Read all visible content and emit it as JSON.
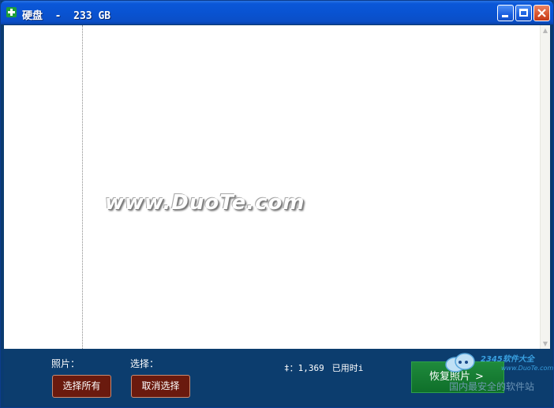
{
  "window": {
    "title": "硬盘  -  233 GB"
  },
  "watermark": "www.DuoTe.com",
  "footer": {
    "photos_label": "照片：",
    "selection_label": "选择：",
    "count_prefix": "‡：1,369",
    "used_time_label": "已用时i",
    "select_all_button": "选择所有",
    "deselect_button": "取消选择",
    "recover_button": "恢复照片",
    "recover_arrow": ">"
  },
  "site_badge": {
    "name": "2345软件大全",
    "url": "www.DuoTe.com",
    "slogan": "国内最安全的软件站"
  },
  "colors": {
    "titlebar": "#0953d2",
    "footer_bg": "#0c3d6e",
    "brown_button": "#6a1a0e",
    "recover_button": "#1f8a3c",
    "close_button": "#d8532c"
  }
}
